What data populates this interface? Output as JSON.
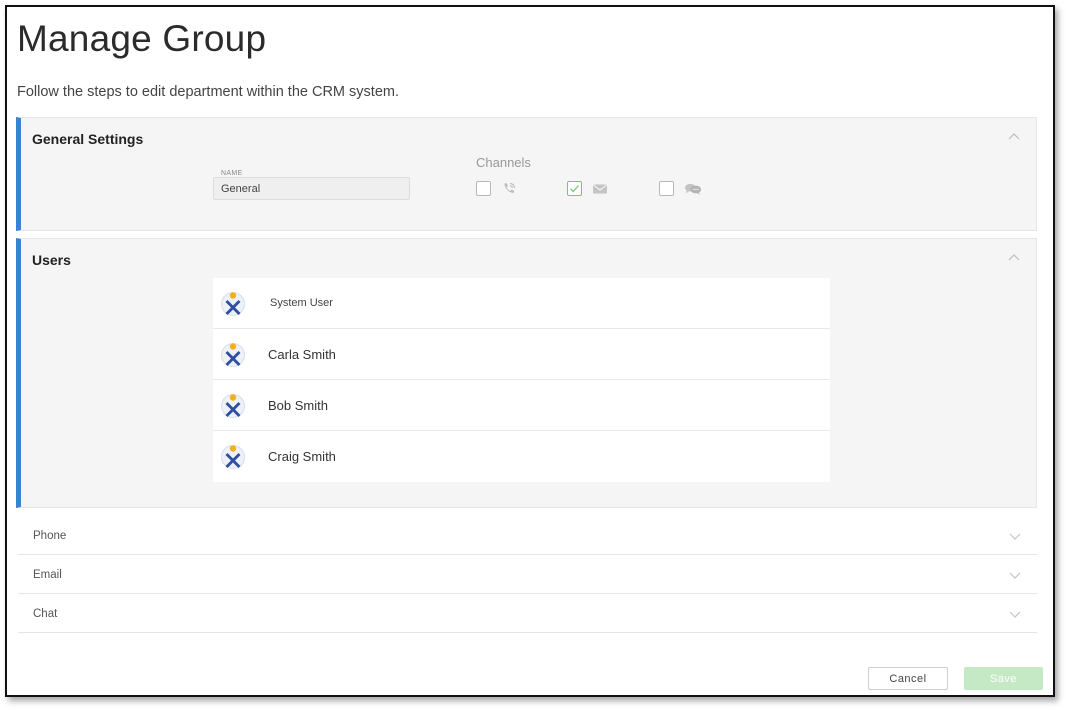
{
  "page": {
    "title": "Manage Group",
    "subtitle": "Follow the steps to edit department within the CRM system."
  },
  "general_settings": {
    "title": "General Settings",
    "name_label": "NAME",
    "name_value": "General",
    "channels_title": "Channels",
    "channels": [
      {
        "icon": "phone-icon",
        "checked": false
      },
      {
        "icon": "envelope-icon",
        "checked": true
      },
      {
        "icon": "chat-bubbles-icon",
        "checked": false
      }
    ]
  },
  "users": {
    "title": "Users",
    "items": [
      {
        "name": "System User"
      },
      {
        "name": "Carla Smith"
      },
      {
        "name": "Bob Smith"
      },
      {
        "name": "Craig Smith"
      }
    ]
  },
  "sections": [
    {
      "label": "Phone"
    },
    {
      "label": "Email"
    },
    {
      "label": "Chat"
    }
  ],
  "buttons": {
    "cancel": "Cancel",
    "save": "Save"
  },
  "colors": {
    "accent": "#3b82d0",
    "checkbox_checked": "#7dc27d",
    "save_disabled": "#c5e9c5",
    "avatar_blue": "#2c4fa3",
    "avatar_yellow": "#f2b01e"
  }
}
